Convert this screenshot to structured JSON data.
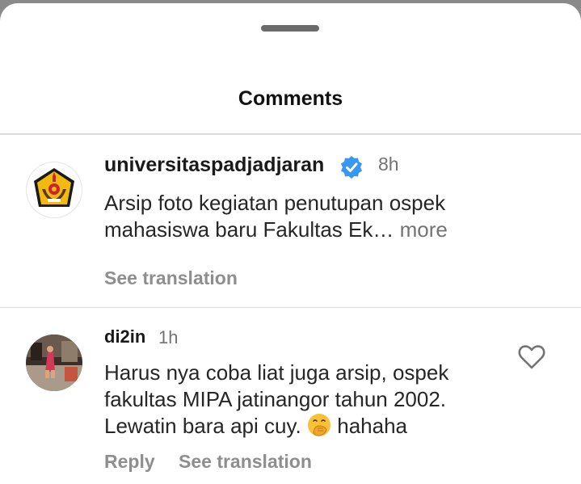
{
  "sheet": {
    "title": "Comments"
  },
  "comments": [
    {
      "username": "universitaspadjadjaran",
      "verified": true,
      "time": "8h",
      "text_line1": "Arsip foto kegiatan penutupan ospek",
      "text_line2": "mahasiswa baru Fakultas Ek…",
      "more_label": " more",
      "see_translation": "See translation",
      "avatar_icon": "university-logo-icon"
    },
    {
      "username": "di2in",
      "time": "1h",
      "text_line1": "Harus nya coba liat juga arsip, ospek",
      "text_line2": "fakultas MIPA jatinangor tahun 2002.",
      "text_line3_a": "Lewatin bara api cuy.",
      "text_line3_b": "hahaha",
      "emoji_icon": "face-with-hand-over-mouth-icon",
      "reply_label": "Reply",
      "see_translation": "See translation",
      "like_icon": "heart-outline-icon"
    }
  ],
  "colors": {
    "background": "#ffffff",
    "text": "#262626",
    "secondary": "#737373",
    "verified": "#3897f0",
    "divider": "#dbdbdb"
  }
}
